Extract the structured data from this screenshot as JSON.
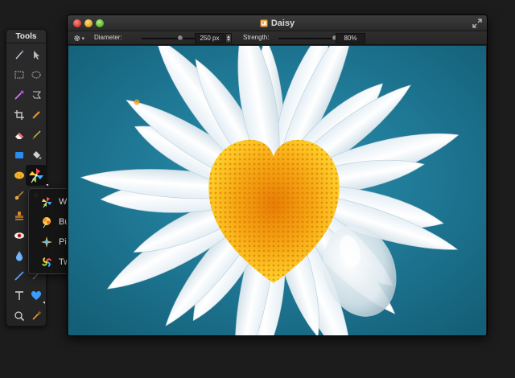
{
  "tools_panel": {
    "title": "Tools",
    "tools": [
      {
        "name": "magic-wand-icon"
      },
      {
        "name": "pointer-icon"
      },
      {
        "name": "rect-select-icon"
      },
      {
        "name": "ellipse-select-icon"
      },
      {
        "name": "color-picker-icon"
      },
      {
        "name": "lasso-icon"
      },
      {
        "name": "crop-icon"
      },
      {
        "name": "pencil-icon"
      },
      {
        "name": "eraser-icon"
      },
      {
        "name": "brush-icon"
      },
      {
        "name": "shape-icon"
      },
      {
        "name": "paint-bucket-icon"
      },
      {
        "name": "sponge-icon"
      },
      {
        "name": "distort-icon"
      },
      {
        "name": "smudge-icon"
      },
      {
        "name": "clone-icon"
      },
      {
        "name": "stamp-icon"
      },
      {
        "name": "eye-icon"
      },
      {
        "name": "drop-icon"
      },
      {
        "name": "pen-icon"
      },
      {
        "name": "type-icon"
      },
      {
        "name": "heart-icon"
      },
      {
        "name": "zoom-icon"
      },
      {
        "name": "eyedropper-icon"
      }
    ]
  },
  "distort_menu": {
    "items": [
      {
        "label": "Warp",
        "icon": "warp-icon"
      },
      {
        "label": "Bump",
        "icon": "bump-icon"
      },
      {
        "label": "Pinch",
        "icon": "pinch-icon"
      },
      {
        "label": "Twirl",
        "icon": "twirl-icon"
      }
    ]
  },
  "window": {
    "title": "Daisy",
    "options": {
      "diameter_label": "Diameter:",
      "diameter_value": "250 px",
      "strength_label": "Strength:",
      "strength_value": "80%",
      "diameter_slider_level": 0.5,
      "strength_slider_level": 0.8
    }
  },
  "colors": {
    "background": "#1c1c1c",
    "petal": "#eef3f6",
    "center": "#f2a90f",
    "sky": "#1d7d9b"
  }
}
